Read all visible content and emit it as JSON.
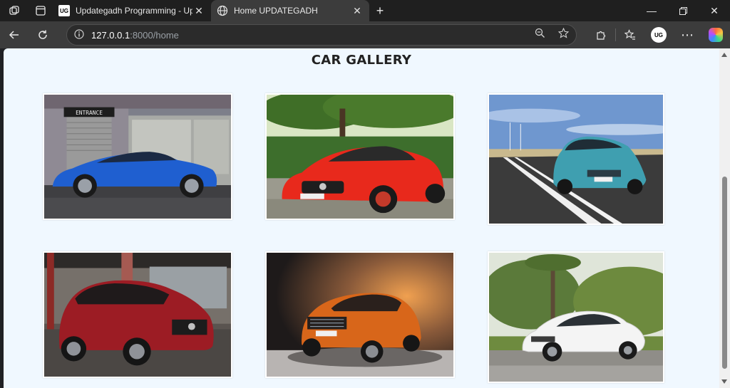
{
  "browser": {
    "tabs": [
      {
        "title": "Updategadh Programming - Upd",
        "favicon": "ug-logo-icon",
        "favicon_text": "UG",
        "active": false
      },
      {
        "title": "Home UPDATEGADH",
        "favicon": "globe-icon",
        "active": true
      }
    ],
    "address": {
      "host": "127.0.0.1",
      "path": ":8000/home"
    },
    "profile_initials": "UG"
  },
  "page": {
    "title": "CAR GALLERY",
    "cars": [
      {
        "name": "blue-coupe",
        "sign_text": "ENTRANCE",
        "body_color": "#1f5fd0"
      },
      {
        "name": "red-sports-car",
        "body_color": "#e8291c"
      },
      {
        "name": "teal-suv",
        "body_color": "#3f9fb0"
      },
      {
        "name": "red-crossover",
        "body_color": "#9c1c24"
      },
      {
        "name": "orange-suv",
        "body_color": "#d8661a"
      },
      {
        "name": "white-sedan",
        "body_color": "#f4f4f4"
      }
    ]
  },
  "colors": {
    "content_bg": "#f0f8ff",
    "chrome_dark": "#1f1f1f",
    "toolbar": "#3c3c3c"
  }
}
